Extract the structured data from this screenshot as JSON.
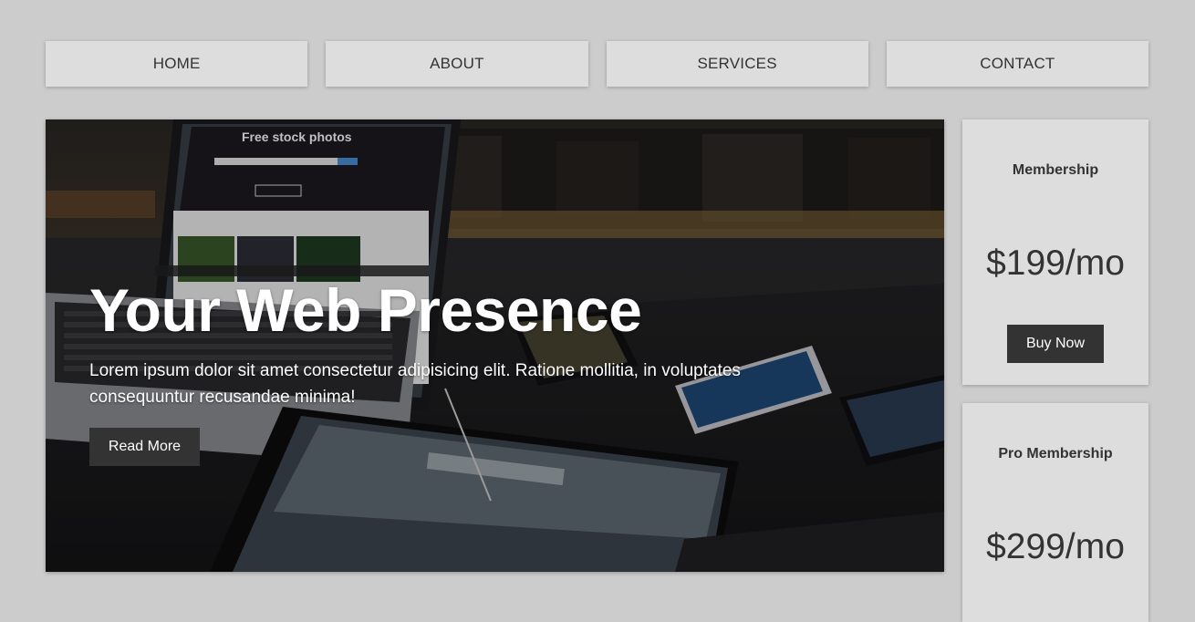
{
  "nav": {
    "items": [
      {
        "label": "HOME"
      },
      {
        "label": "ABOUT"
      },
      {
        "label": "SERVICES"
      },
      {
        "label": "CONTACT"
      }
    ]
  },
  "hero": {
    "title": "Your Web Presence",
    "text": "Lorem ipsum dolor sit amet consectetur adipisicing elit. Ratione mollitia, in voluptates consequuntur recusandae minima!",
    "button_label": "Read More",
    "laptop_screen_heading": "Free stock photos"
  },
  "cards": [
    {
      "title": "Membership",
      "price": "$199/mo",
      "button_label": "Buy Now"
    },
    {
      "title": "Pro Membership",
      "price": "$299/mo"
    }
  ],
  "colors": {
    "page_bg": "#cccccc",
    "panel_bg": "#dddddd",
    "button_bg": "#333333",
    "text_dark": "#333333"
  }
}
